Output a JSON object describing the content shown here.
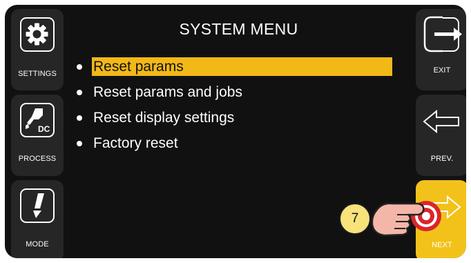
{
  "screen": {
    "title": "SYSTEM MENU"
  },
  "left_buttons": [
    {
      "label": "SETTINGS",
      "icon": "gear-icon"
    },
    {
      "label": "PROCESS",
      "icon": "welding-torch-dc-icon",
      "icon_text": "DC"
    },
    {
      "label": "MODE",
      "icon": "torch-trigger-icon"
    }
  ],
  "right_buttons": [
    {
      "label": "EXIT",
      "icon": "exit-arrow-icon"
    },
    {
      "label": "PREV.",
      "icon": "left-arrow-icon"
    },
    {
      "label": "NEXT",
      "icon": "right-arrow-icon"
    }
  ],
  "menu": {
    "items": [
      {
        "label": "Reset params",
        "selected": true
      },
      {
        "label": "Reset params and jobs",
        "selected": false
      },
      {
        "label": "Reset display settings",
        "selected": false
      },
      {
        "label": "Factory reset",
        "selected": false
      }
    ]
  },
  "callout": {
    "step": "7"
  },
  "colors": {
    "background": "#111111",
    "button": "#262626",
    "highlight": "#f2b817",
    "next_button": "#f2c21a",
    "badge": "#f8e27a",
    "touch_ring": "#d9262c"
  }
}
